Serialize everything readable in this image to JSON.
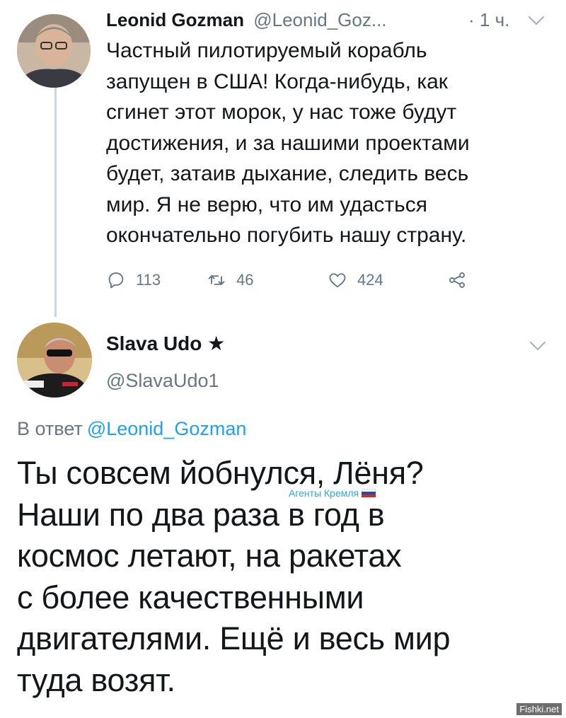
{
  "tweet1": {
    "author_name": "Leonid Gozman",
    "author_handle": "@Leonid_Goz...",
    "time": "· 1 ч.",
    "lines": [
      "Частный пилотируемый корабль",
      "запущен в США! Когда-нибудь, как",
      "сгинет этот морок, у нас тоже будут",
      "достижения, и за нашими проектами",
      "будет, затаив дыхание, следить весь",
      "мир. Я не верю, что им удасться",
      "окончательно погубить нашу страну."
    ],
    "actions": {
      "replies": "113",
      "retweets": "46",
      "likes": "424"
    }
  },
  "tweet2": {
    "author_name": "Slava Udo ★",
    "author_handle": "@SlavaUdo1",
    "reply_prefix": "В ответ",
    "reply_mention": "@Leonid_Gozman",
    "lines": [
      "Ты совсем йобнулся, Лёня?",
      "Наши по два раза в год в",
      "космос летают, на ракетах",
      "с более качественными",
      "двигателями. Ещё и весь мир",
      "туда возят."
    ]
  },
  "overlay": {
    "watermark": "Агенты Кремля",
    "site": "Fishki.net"
  },
  "colors": {
    "link": "#1da1f2",
    "muted": "#657786",
    "text": "#14171a"
  },
  "icons": [
    "reply-icon",
    "retweet-icon",
    "like-icon",
    "share-icon",
    "chevron-down-icon"
  ]
}
